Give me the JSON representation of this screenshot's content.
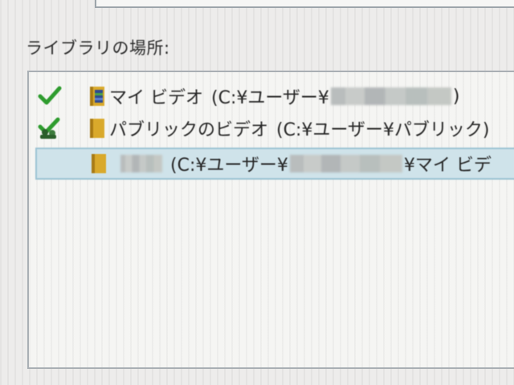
{
  "section": {
    "title": "ライブラリの場所:"
  },
  "locations": [
    {
      "name": "マイ ビデオ",
      "path_prefix": "(C:¥ユーザー¥",
      "path_suffix": ")",
      "status_icon": "checkmark-icon",
      "folder_icon": "video-folder-icon"
    },
    {
      "name": "パブリックのビデオ",
      "path_prefix": "(C:¥ユーザー¥パブリック)",
      "status_icon": "shared-check-icon",
      "folder_icon": "folder-icon"
    },
    {
      "path_prefix": "(C:¥ユーザー¥",
      "path_suffix": "¥マイ ビデ",
      "selected": true,
      "folder_icon": "folder-icon"
    }
  ],
  "colors": {
    "check_green": "#2e9c2e",
    "folder_yellow": "#d9a92b",
    "selection_bg": "#cfe3ea",
    "selection_border": "#9cc3d3"
  }
}
